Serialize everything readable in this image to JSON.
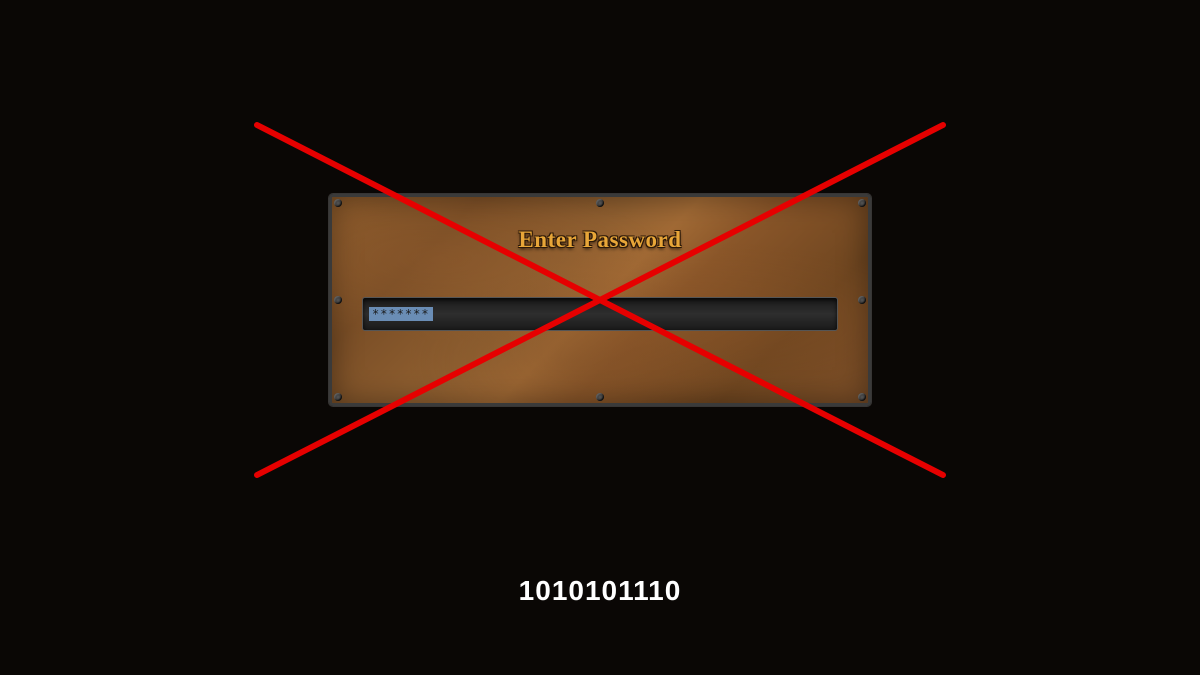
{
  "dialog": {
    "title": "Enter Password",
    "password_masked": "*******"
  },
  "caption": "1010101110",
  "colors": {
    "cross": "#e60000",
    "title": "#e8a638"
  }
}
